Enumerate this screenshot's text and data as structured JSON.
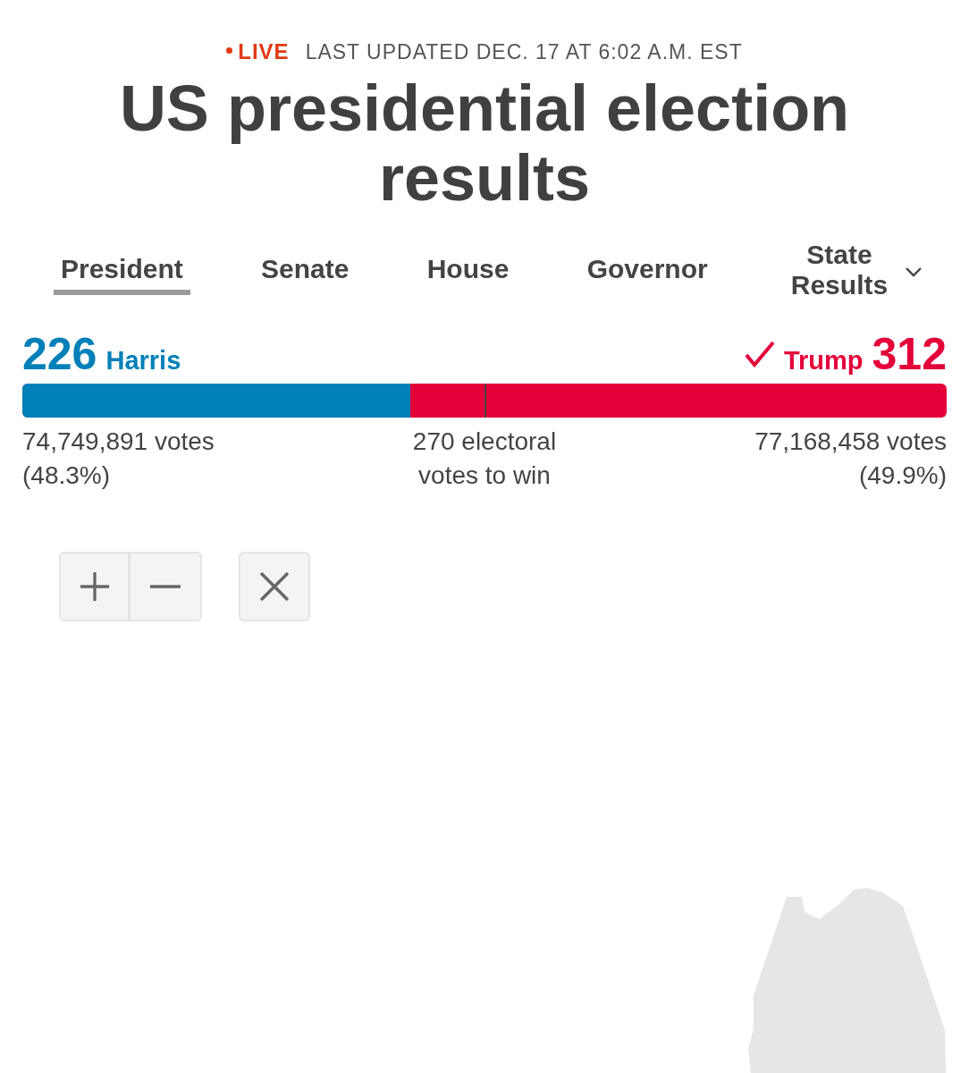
{
  "header": {
    "live_label": "LIVE",
    "updated": "LAST UPDATED DEC. 17 AT 6:02 A.M. EST"
  },
  "title": "US presidential election results",
  "tabs": [
    {
      "label": "President",
      "selected": true,
      "kind": "tab"
    },
    {
      "label": "Senate",
      "selected": false,
      "kind": "tab"
    },
    {
      "label": "House",
      "selected": false,
      "kind": "tab"
    },
    {
      "label": "Governor",
      "selected": false,
      "kind": "tab"
    },
    {
      "label": "State Results",
      "selected": false,
      "kind": "dropdown"
    }
  ],
  "results": {
    "candidates": [
      {
        "name": "Harris",
        "electoral_votes": "226",
        "color": "#0080b8",
        "winner": false,
        "votes": "74,749,891 votes",
        "share": "(48.3%)"
      },
      {
        "name": "Trump",
        "electoral_votes": "312",
        "color": "#e4003a",
        "winner": true,
        "votes": "77,168,458 votes",
        "share": "(49.9%)"
      }
    ],
    "bar": {
      "level": 0.42
    },
    "threshold": "270 electoral votes to win"
  }
}
